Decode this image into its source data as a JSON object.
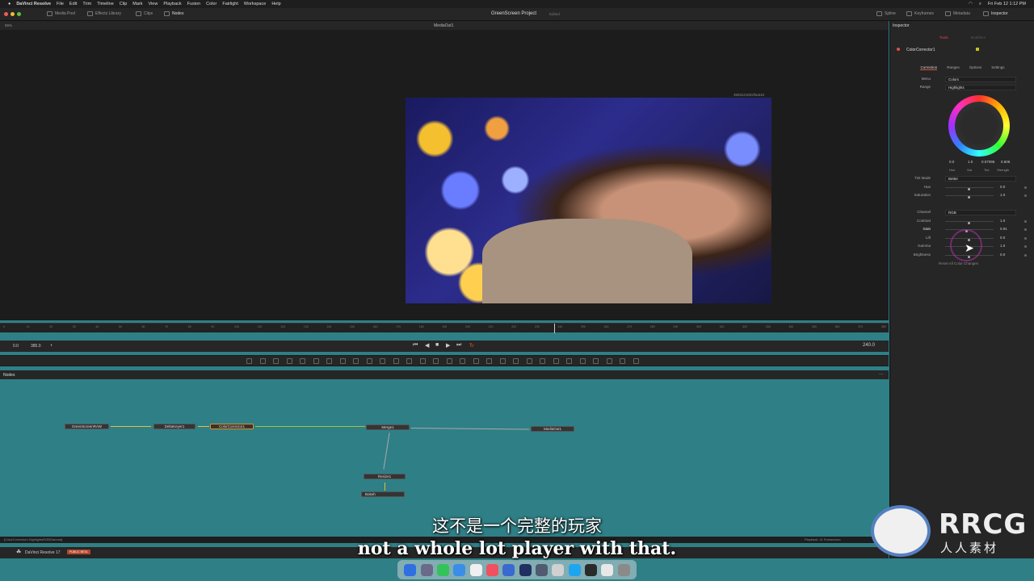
{
  "menubar": {
    "app": "DaVinci Resolve",
    "items": [
      "File",
      "Edit",
      "Trim",
      "Timeline",
      "Clip",
      "Mark",
      "View",
      "Playback",
      "Fusion",
      "Color",
      "Fairlight",
      "Workspace",
      "Help"
    ],
    "clock": "Fri Feb 12  1:12 PM"
  },
  "toolbar": {
    "media_pool": "Media Pool",
    "effects_library": "Effects Library",
    "clips": "Clips",
    "nodes": "Nodes",
    "project": "GreenScreen Project",
    "project_status": "Edited",
    "spline": "Spline",
    "keyframes": "Keyframes",
    "metadata": "Metadata",
    "inspector": "Inspector"
  },
  "viewer": {
    "zoom": "55%",
    "title": "MediaOut1",
    "resolution": "3840x2160xfloat16"
  },
  "timeline": {
    "ticks": [
      "0",
      "10",
      "20",
      "30",
      "40",
      "50",
      "60",
      "70",
      "80",
      "90",
      "100",
      "110",
      "120",
      "130",
      "140",
      "150",
      "160",
      "170",
      "180",
      "190",
      "200",
      "210",
      "220",
      "230",
      "240",
      "250",
      "260",
      "270",
      "280",
      "290",
      "300",
      "310",
      "320",
      "330",
      "340",
      "350",
      "360",
      "370",
      "380"
    ],
    "start": "0.0",
    "end": "385.0",
    "current": "240.0"
  },
  "nodes_panel": {
    "title": "Nodes",
    "nodes": [
      "GreenScreenRAW",
      "DeltaKeyer1",
      "ColorCorrector1",
      "Merge1",
      "MediaOut1",
      "Resize1",
      "Bokeh"
    ]
  },
  "status": {
    "path": "[ColorCorrector1.HighlightsRGBGamma]",
    "playback": "Playback: 11 Frames/sec"
  },
  "footer": {
    "app_name": "DaVinci Resolve 17",
    "badge": "PUBLIC BETA"
  },
  "inspector": {
    "title": "Inspector",
    "tabs": [
      "Tools",
      "Modifiers"
    ],
    "tool_name": "ColorCorrector1",
    "subtabs": [
      "Correction",
      "Ranges",
      "Options",
      "Settings"
    ],
    "menu_label": "Menu",
    "menu_value": "Colors",
    "range_label": "Range",
    "range_value": "Highlights",
    "wheel_values": [
      "0.0",
      "1.0",
      "0.07096",
      "0.606"
    ],
    "wheel_labels": [
      "Hue",
      "Sat",
      "Tint",
      "Strength"
    ],
    "tint_mode_label": "Tint Mode",
    "tint_mode_value": "Better",
    "hue_label": "Hue",
    "hue_value": "0.0",
    "saturation_label": "Saturation",
    "saturation_value": "1.0",
    "channel_label": "Channel",
    "channel_value": "RGB",
    "contrast_label": "Contrast",
    "contrast_value": "1.0",
    "gain_label": "Gain",
    "gain_value": "0.91",
    "lift_label": "Lift",
    "lift_value": "0.0",
    "gamma_label": "Gamma",
    "gamma_value": "1.0",
    "brightness_label": "Brightness",
    "brightness_value": "0.0",
    "reset_label": "Reset All Color Changes"
  },
  "subtitles": {
    "chinese": "这不是一个完整的玩家",
    "english": "not a whole lot player with that."
  },
  "watermark": {
    "text": "RRCG",
    "cn": "人人素材"
  }
}
